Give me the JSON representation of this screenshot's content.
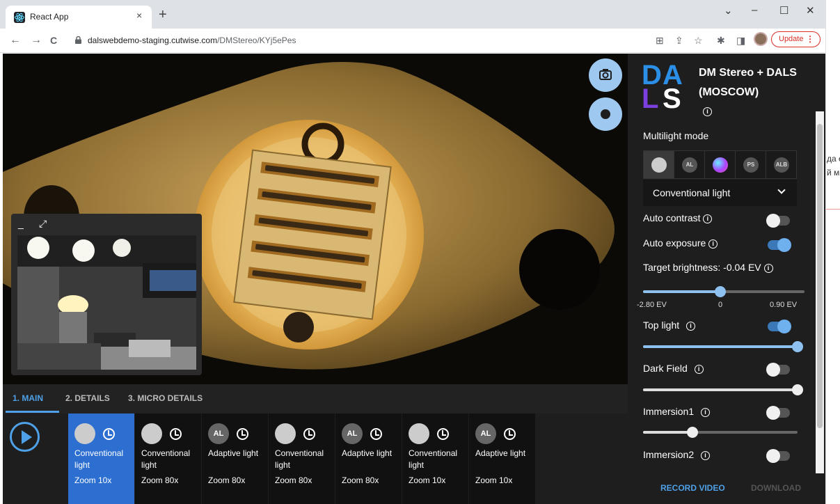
{
  "browser": {
    "tab_title": "React App",
    "tab_close": "×",
    "new_tab": "+",
    "url_domain": "dalswebdemo-staging.cutwise.com",
    "url_path": "/DMStereo/KYj5ePes",
    "update_label": "Update",
    "update_menu": "⋮",
    "back": "←",
    "forward": "→",
    "reload": "C",
    "share_icon": "⇪",
    "install_icon": "⊞",
    "star": "☆",
    "extension_icon": "✱",
    "sidebar_icon": "◨",
    "win_dropdown": "⌄",
    "win_min": "–",
    "win_max": "☐",
    "win_close": "✕"
  },
  "rightstrip": {
    "line1": "да е",
    "line2": "й м"
  },
  "viewer": {
    "mini_minimize": "_",
    "mini_expand": "⤢"
  },
  "tabs": [
    {
      "label": "1. MAIN",
      "active": true
    },
    {
      "label": "2. DETAILS",
      "active": false
    },
    {
      "label": "3. MICRO DETAILS",
      "active": false
    }
  ],
  "cards": [
    {
      "icon": "",
      "label": "Conventional light",
      "zoom": "Zoom 10x",
      "selected": true
    },
    {
      "icon": "",
      "label": "Conventional light",
      "zoom": "Zoom 80x",
      "selected": false
    },
    {
      "icon": "AL",
      "label": "Adaptive light",
      "zoom": "Zoom 80x",
      "selected": false
    },
    {
      "icon": "",
      "label": "Conventional light",
      "zoom": "Zoom 80x",
      "selected": false
    },
    {
      "icon": "AL",
      "label": "Adaptive light",
      "zoom": "Zoom 80x",
      "selected": false
    },
    {
      "icon": "",
      "label": "Conventional light",
      "zoom": "Zoom 10x",
      "selected": false
    },
    {
      "icon": "AL",
      "label": "Adaptive light",
      "zoom": "Zoom 10x",
      "selected": false
    }
  ],
  "panel": {
    "logo": [
      "D",
      "A",
      "L",
      "S"
    ],
    "title": "DM Stereo + DALS (MOSCOW)",
    "info_glyph": "i",
    "multilight_label": "Multilight mode",
    "modes": [
      {
        "icon": "",
        "selected": true
      },
      {
        "icon": "AL",
        "selected": false
      },
      {
        "icon": "",
        "selected": false
      },
      {
        "icon": "PS",
        "selected": false
      },
      {
        "icon": "ALB",
        "selected": false
      }
    ],
    "mode_value": "Conventional light",
    "auto_contrast": {
      "label": "Auto contrast",
      "on": false
    },
    "auto_exposure": {
      "label": "Auto exposure",
      "on": true
    },
    "brightness": {
      "label": "Target brightness: -0.04 EV",
      "min": "-2.80 EV",
      "mid": "0",
      "max": "0.90 EV",
      "level": 0.48
    },
    "top_light": {
      "label": "Top light",
      "on": true,
      "level": 1.0
    },
    "dark_field": {
      "label": "Dark Field",
      "on": false,
      "level": 1.0
    },
    "immersion1": {
      "label": "Immersion1",
      "on": false,
      "level": 0.32
    },
    "immersion2": {
      "label": "Immersion2",
      "on": false
    },
    "record_video": "RECORD VIDEO",
    "download": "DOWNLOAD",
    "accent": "#4ea1e8"
  }
}
